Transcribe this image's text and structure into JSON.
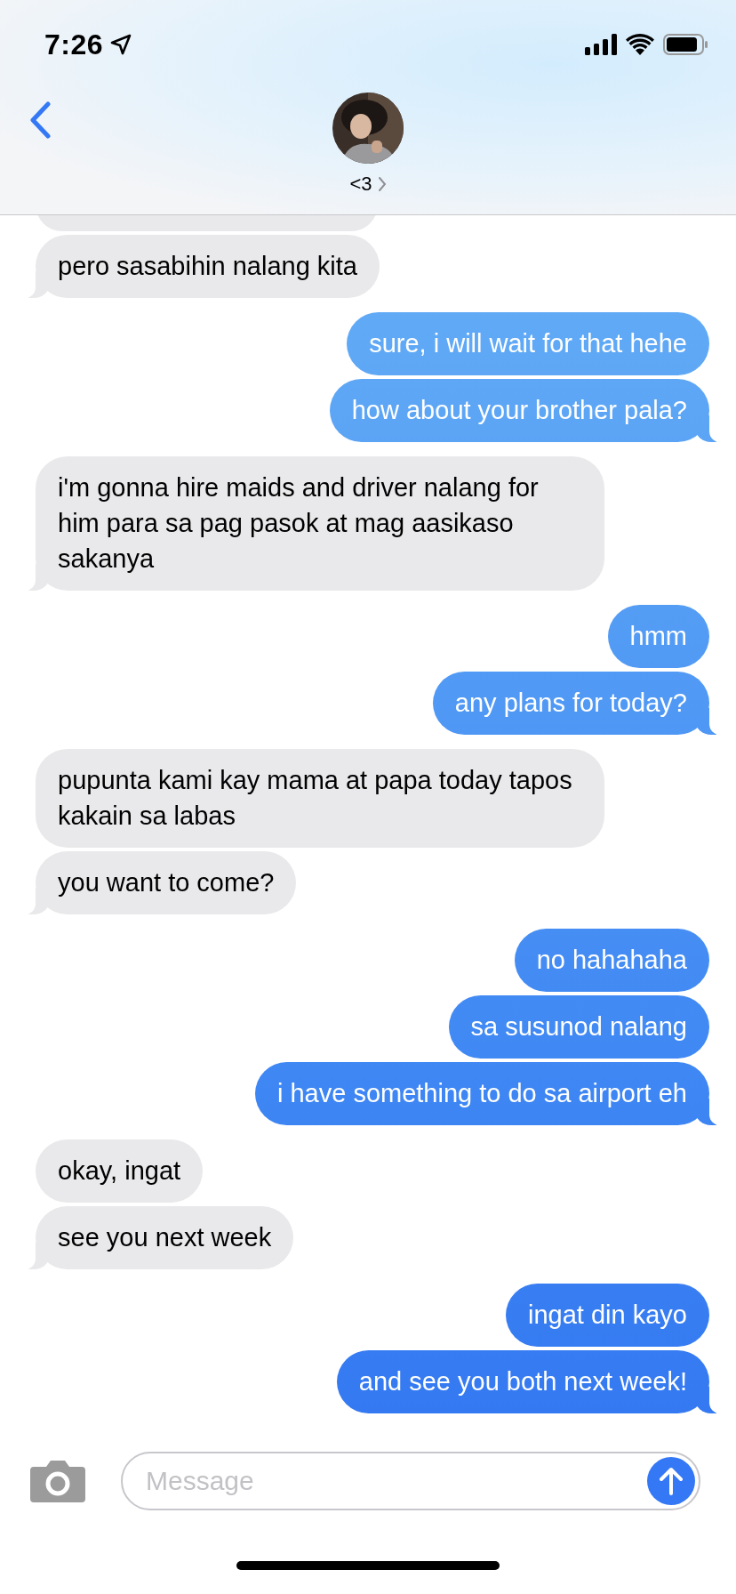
{
  "status_bar": {
    "time": "7:26"
  },
  "contact": {
    "name": "<3"
  },
  "messages": [
    {
      "kind": "received",
      "text": "pero sasabihin nalang kita"
    },
    {
      "kind": "sent",
      "text": "sure, i will wait for that hehe"
    },
    {
      "kind": "sent",
      "text": "how about your brother pala?"
    },
    {
      "kind": "received",
      "text": "i'm gonna hire maids and driver nalang for him para sa pag pasok at mag aasikaso sakanya"
    },
    {
      "kind": "sent",
      "text": "hmm"
    },
    {
      "kind": "sent",
      "text": "any plans for today?"
    },
    {
      "kind": "received",
      "text": "pupunta kami kay mama at papa today tapos kakain sa labas"
    },
    {
      "kind": "received",
      "text": "you want to come?"
    },
    {
      "kind": "sent",
      "text": "no hahahaha"
    },
    {
      "kind": "sent",
      "text": "sa susunod nalang"
    },
    {
      "kind": "sent",
      "text": "i have something to do sa airport eh"
    },
    {
      "kind": "received",
      "text": "okay, ingat"
    },
    {
      "kind": "received",
      "text": "see you next week"
    },
    {
      "kind": "sent",
      "text": "ingat din kayo"
    },
    {
      "kind": "sent",
      "text": "and see you both next week!"
    }
  ],
  "composer": {
    "placeholder": "Message"
  }
}
